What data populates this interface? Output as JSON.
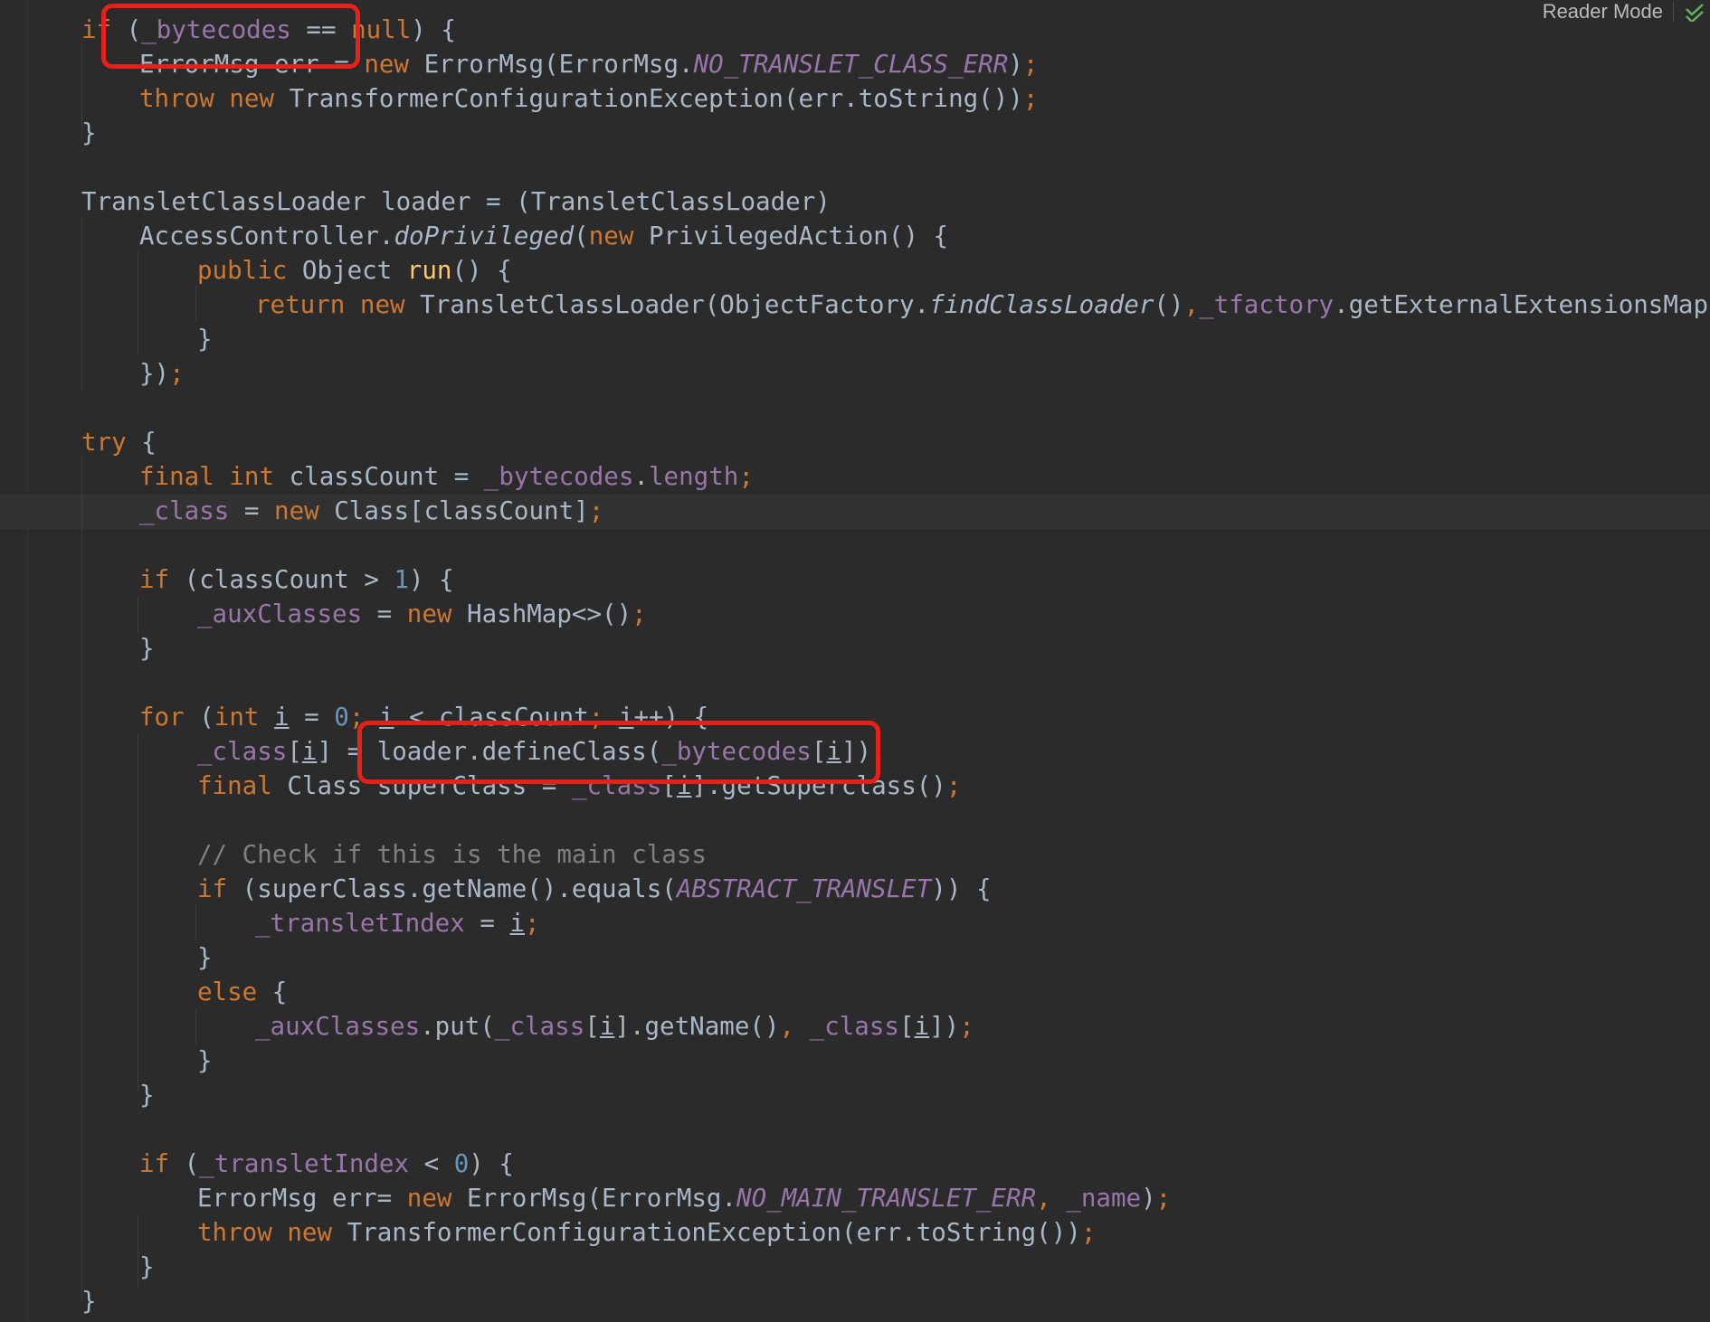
{
  "toolbar": {
    "reader_mode_label": "Reader Mode",
    "check_icon": "check-icon"
  },
  "colors": {
    "background": "#2b2b2b",
    "keyword": "#cc7832",
    "field": "#9876aa",
    "number": "#6897bb",
    "comment": "#808080",
    "default_text": "#a9b7c6",
    "method_decl": "#ffc66d",
    "annotation_box": "#e8201a"
  },
  "code": {
    "tok": {
      "if": "if",
      "null": "null",
      "new": "new",
      "throw": "throw",
      "try": "try",
      "final": "final",
      "int": "int",
      "for": "for",
      "else": "else",
      "public": "public",
      "return": "return",
      "semi": ";",
      "comma": ","
    },
    "l1": {
      "a": " (",
      "b": "_bytecodes",
      "c": " == ",
      "d": ") {"
    },
    "l2": {
      "a": "ErrorMsg err = ",
      "b": " ErrorMsg(ErrorMsg.",
      "c": "NO_TRANSLET_CLASS_ERR",
      "d": ")"
    },
    "l3": {
      "a": " TransformerConfigurationException(err.toString())"
    },
    "l4": {
      "a": "}"
    },
    "l5": {
      "a": "TransletClassLoader loader = (TransletClassLoader)"
    },
    "l6": {
      "a": "AccessController.",
      "b": "doPrivileged",
      "c": "(",
      "d": " PrivilegedAction() {"
    },
    "l7": {
      "a": " Object ",
      "b": "run",
      "c": "() {"
    },
    "l8": {
      "a": " TransletClassLoader(ObjectFactory.",
      "b": "findClassLoader",
      "c": "()",
      "d": "_tfactory",
      "e": ".getExternalExtensionsMap())"
    },
    "l9": {
      "a": "}"
    },
    "l10": {
      "a": "})"
    },
    "l11": {
      "a": " {"
    },
    "l12": {
      "a": " classCount = ",
      "b": "_bytecodes",
      "c": ".",
      "d": "length"
    },
    "l13": {
      "a": "_class",
      "b": " = ",
      "c": " Class[classCount]"
    },
    "l14": {
      "a": " (classCount > ",
      "b": "1",
      "c": ") {"
    },
    "l15": {
      "a": "_auxClasses",
      "b": " = ",
      "c": " HashMap<>()"
    },
    "l16": {
      "a": "}"
    },
    "l17": {
      "a": " (",
      "b": " ",
      "c": "i",
      "d": " = ",
      "e": "0",
      "f": " ",
      "g": "i",
      "h": " < classCount",
      "i": " ",
      "j": "i",
      "k": "++) {"
    },
    "l18": {
      "a": "_class",
      "b": "[",
      "c": "i",
      "d": "] = loader.defineClass(",
      "e": "_bytecodes",
      "f": "[",
      "g": "i",
      "h": "])"
    },
    "l19": {
      "a": " Class superClass = ",
      "b": "_class",
      "c": "[",
      "d": "i",
      "e": "].getSuperclass()"
    },
    "l20": {
      "a": "// Check if this is the main class"
    },
    "l21": {
      "a": " (superClass.getName().equals(",
      "b": "ABSTRACT_TRANSLET",
      "c": ")) {"
    },
    "l22": {
      "a": "_transletIndex",
      "b": " = ",
      "c": "i"
    },
    "l23": {
      "a": "}"
    },
    "l24": {
      "a": " {"
    },
    "l25": {
      "a": "_auxClasses",
      "b": ".put(",
      "c": "_class",
      "d": "[",
      "e": "i",
      "f": "].getName()",
      "g": " ",
      "h": "_class",
      "i": "[",
      "j": "i",
      "k": "])"
    },
    "l26": {
      "a": "}"
    },
    "l27": {
      "a": "}"
    },
    "l28": {
      "a": " (",
      "b": "_transletIndex",
      "c": " < ",
      "d": "0",
      "e": ") {"
    },
    "l29": {
      "a": "ErrorMsg err= ",
      "b": " ErrorMsg(ErrorMsg.",
      "c": "NO_MAIN_TRANSLET_ERR",
      "d": " ",
      "e": "_name",
      "f": ")"
    },
    "l30": {
      "a": " TransformerConfigurationException(err.toString())"
    },
    "l31": {
      "a": "}"
    },
    "l32": {
      "a": "}"
    }
  }
}
